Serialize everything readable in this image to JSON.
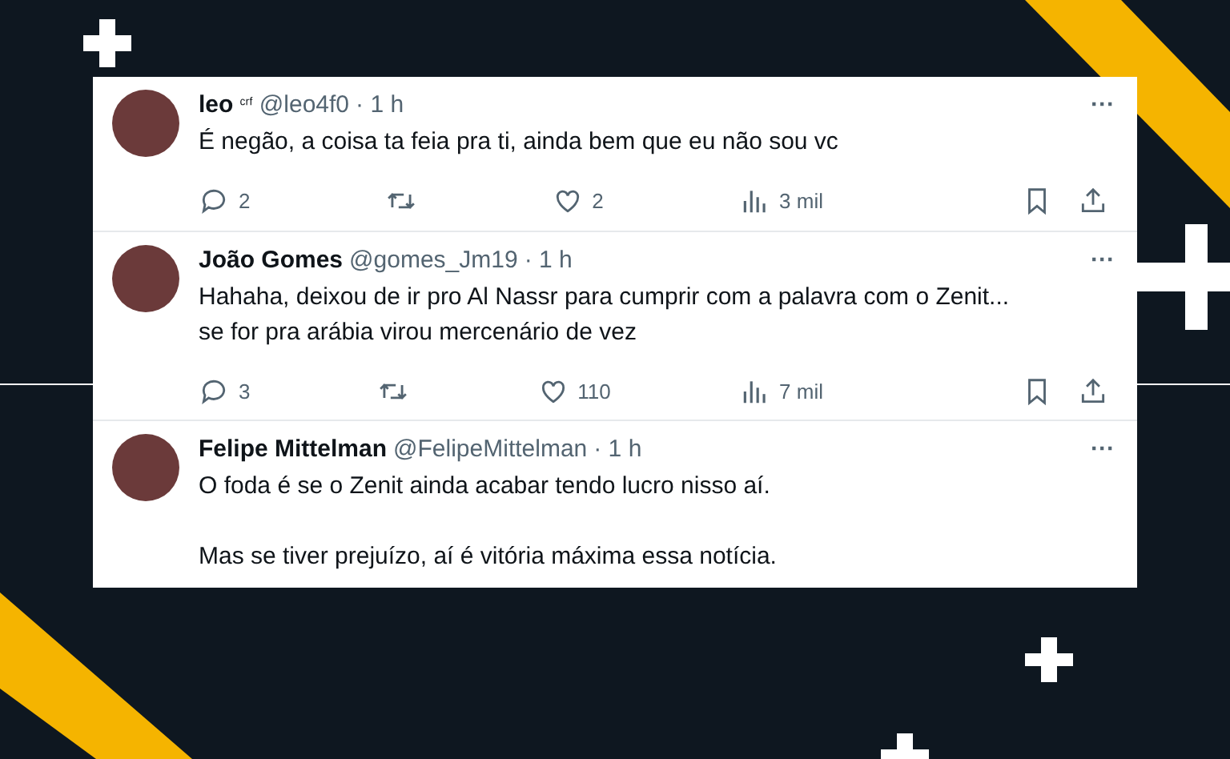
{
  "tweets": [
    {
      "name": "leo",
      "badge": "ᶜʳᶠ",
      "handle": "@leo4f0",
      "time": "· 1 h",
      "more": "···",
      "text": [
        "É negão, a coisa ta feia pra ti, ainda bem que eu não sou vc"
      ],
      "actions": {
        "replies": "2",
        "likes": "2",
        "views": "3 mil"
      }
    },
    {
      "name": "João Gomes",
      "handle": "@gomes_Jm19",
      "time": "· 1 h",
      "more": "···",
      "text": [
        "Hahaha, deixou de ir pro  Al Nassr para cumprir com a palavra com o Zenit... se for pra arábia virou mercenário de vez"
      ],
      "actions": {
        "replies": "3",
        "likes": "110",
        "views": "7 mil"
      }
    },
    {
      "name": "Felipe Mittelman",
      "handle": "@FelipeMittelman",
      "time": "· 1 h",
      "more": "···",
      "text": [
        "O foda é se o Zenit ainda acabar tendo lucro nisso aí.",
        "Mas se tiver prejuízo, aí é vitória máxima essa notícia."
      ]
    }
  ]
}
